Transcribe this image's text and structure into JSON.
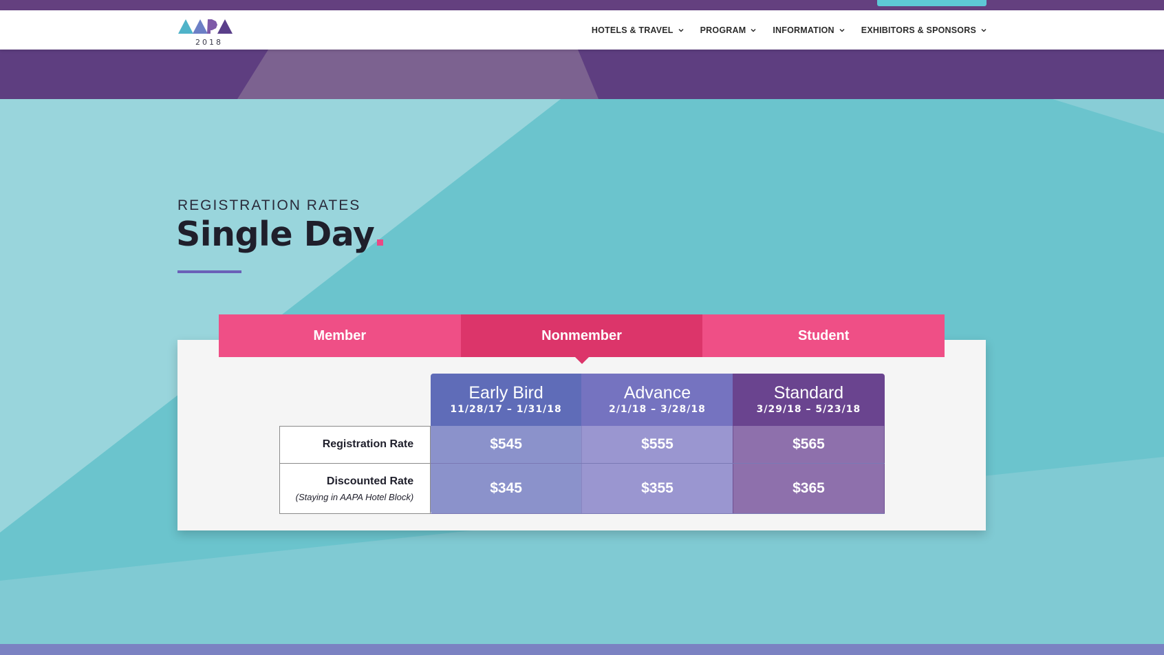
{
  "header": {
    "logo_text": "AAPA",
    "logo_year": "2018",
    "nav": [
      {
        "label": "HOTELS & TRAVEL"
      },
      {
        "label": "PROGRAM"
      },
      {
        "label": "INFORMATION"
      },
      {
        "label": "EXHIBITORS & SPONSORS"
      }
    ]
  },
  "page": {
    "eyebrow": "REGISTRATION RATES",
    "title": "Single Day"
  },
  "tabs": [
    {
      "label": "Member",
      "active": false
    },
    {
      "label": "Nonmember",
      "active": true
    },
    {
      "label": "Student",
      "active": false
    }
  ],
  "rate_table": {
    "columns": [
      {
        "name": "Early Bird",
        "dates": "11/28/17 – 1/31/18"
      },
      {
        "name": "Advance",
        "dates": "2/1/18 – 3/28/18"
      },
      {
        "name": "Standard",
        "dates": "3/29/18 – 5/23/18"
      }
    ],
    "rows": [
      {
        "label": "Registration Rate",
        "sublabel": "",
        "values": [
          "$545",
          "$555",
          "$565"
        ]
      },
      {
        "label": "Discounted Rate",
        "sublabel": "(Staying in AAPA Hotel Block)",
        "values": [
          "$345",
          "$355",
          "$365"
        ]
      }
    ]
  },
  "colors": {
    "brand_purple": "#64407f",
    "tab_pink": "#ef4f86",
    "tab_active": "#dc356a",
    "accent_teal": "#6bc4cd"
  }
}
